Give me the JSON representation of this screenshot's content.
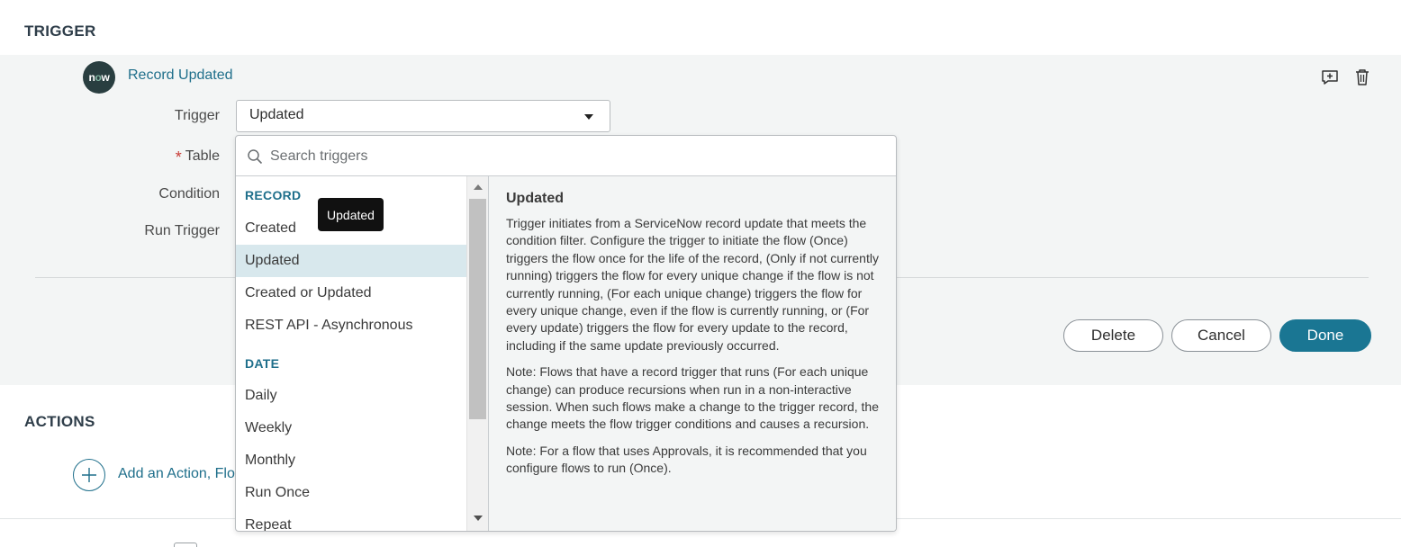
{
  "sections": {
    "trigger_title": "TRIGGER",
    "actions_title": "ACTIONS"
  },
  "trigger_card": {
    "logo_text": {
      "n": "n",
      "o": "o",
      "w": "w"
    },
    "title": "Record Updated",
    "icons": [
      "add-comment-icon",
      "trash-icon"
    ]
  },
  "form": {
    "trigger_label": "Trigger",
    "trigger_value": "Updated",
    "required_marker": "*",
    "table_label": "Table",
    "condition_label": "Condition",
    "run_trigger_label": "Run Trigger"
  },
  "buttons": {
    "delete": "Delete",
    "cancel": "Cancel",
    "done": "Done"
  },
  "actions": {
    "add_action_label": "Add an Action, Flo"
  },
  "dropdown": {
    "search_placeholder": "Search triggers",
    "groups": [
      {
        "header": "RECORD",
        "items": [
          "Created",
          "Updated",
          "Created or Updated",
          "REST API - Asynchronous"
        ]
      },
      {
        "header": "DATE",
        "items": [
          "Daily",
          "Weekly",
          "Monthly",
          "Run Once",
          "Repeat"
        ]
      }
    ],
    "selected_item": "Updated",
    "tooltip": "Updated",
    "description": {
      "title": "Updated",
      "paragraphs": [
        "Trigger initiates from a ServiceNow record update that meets the condition filter. Configure the trigger to initiate the flow (Once) triggers the flow once for the life of the record, (Only if not currently running) triggers the flow for every unique change if the flow is not currently running, (For each unique change) triggers the flow for every unique change, even if the flow is currently running, or (For every update) triggers the flow for every update to the record, including if the same update previously occurred.",
        "Note: Flows that have a record trigger that runs (For each unique change) can produce recursions when run in a non-interactive session. When such flows make a change to the trigger record, the change meets the flow trigger conditions and causes a recursion.",
        "Note: For a flow that uses Approvals, it is recommended that you configure flows to run (Once)."
      ]
    }
  },
  "colors": {
    "accent": "#1a7693",
    "link": "#1f6f8b",
    "panel_bg": "#f3f5f5",
    "selected_bg": "#d8e8ed",
    "required": "#c83c36"
  }
}
